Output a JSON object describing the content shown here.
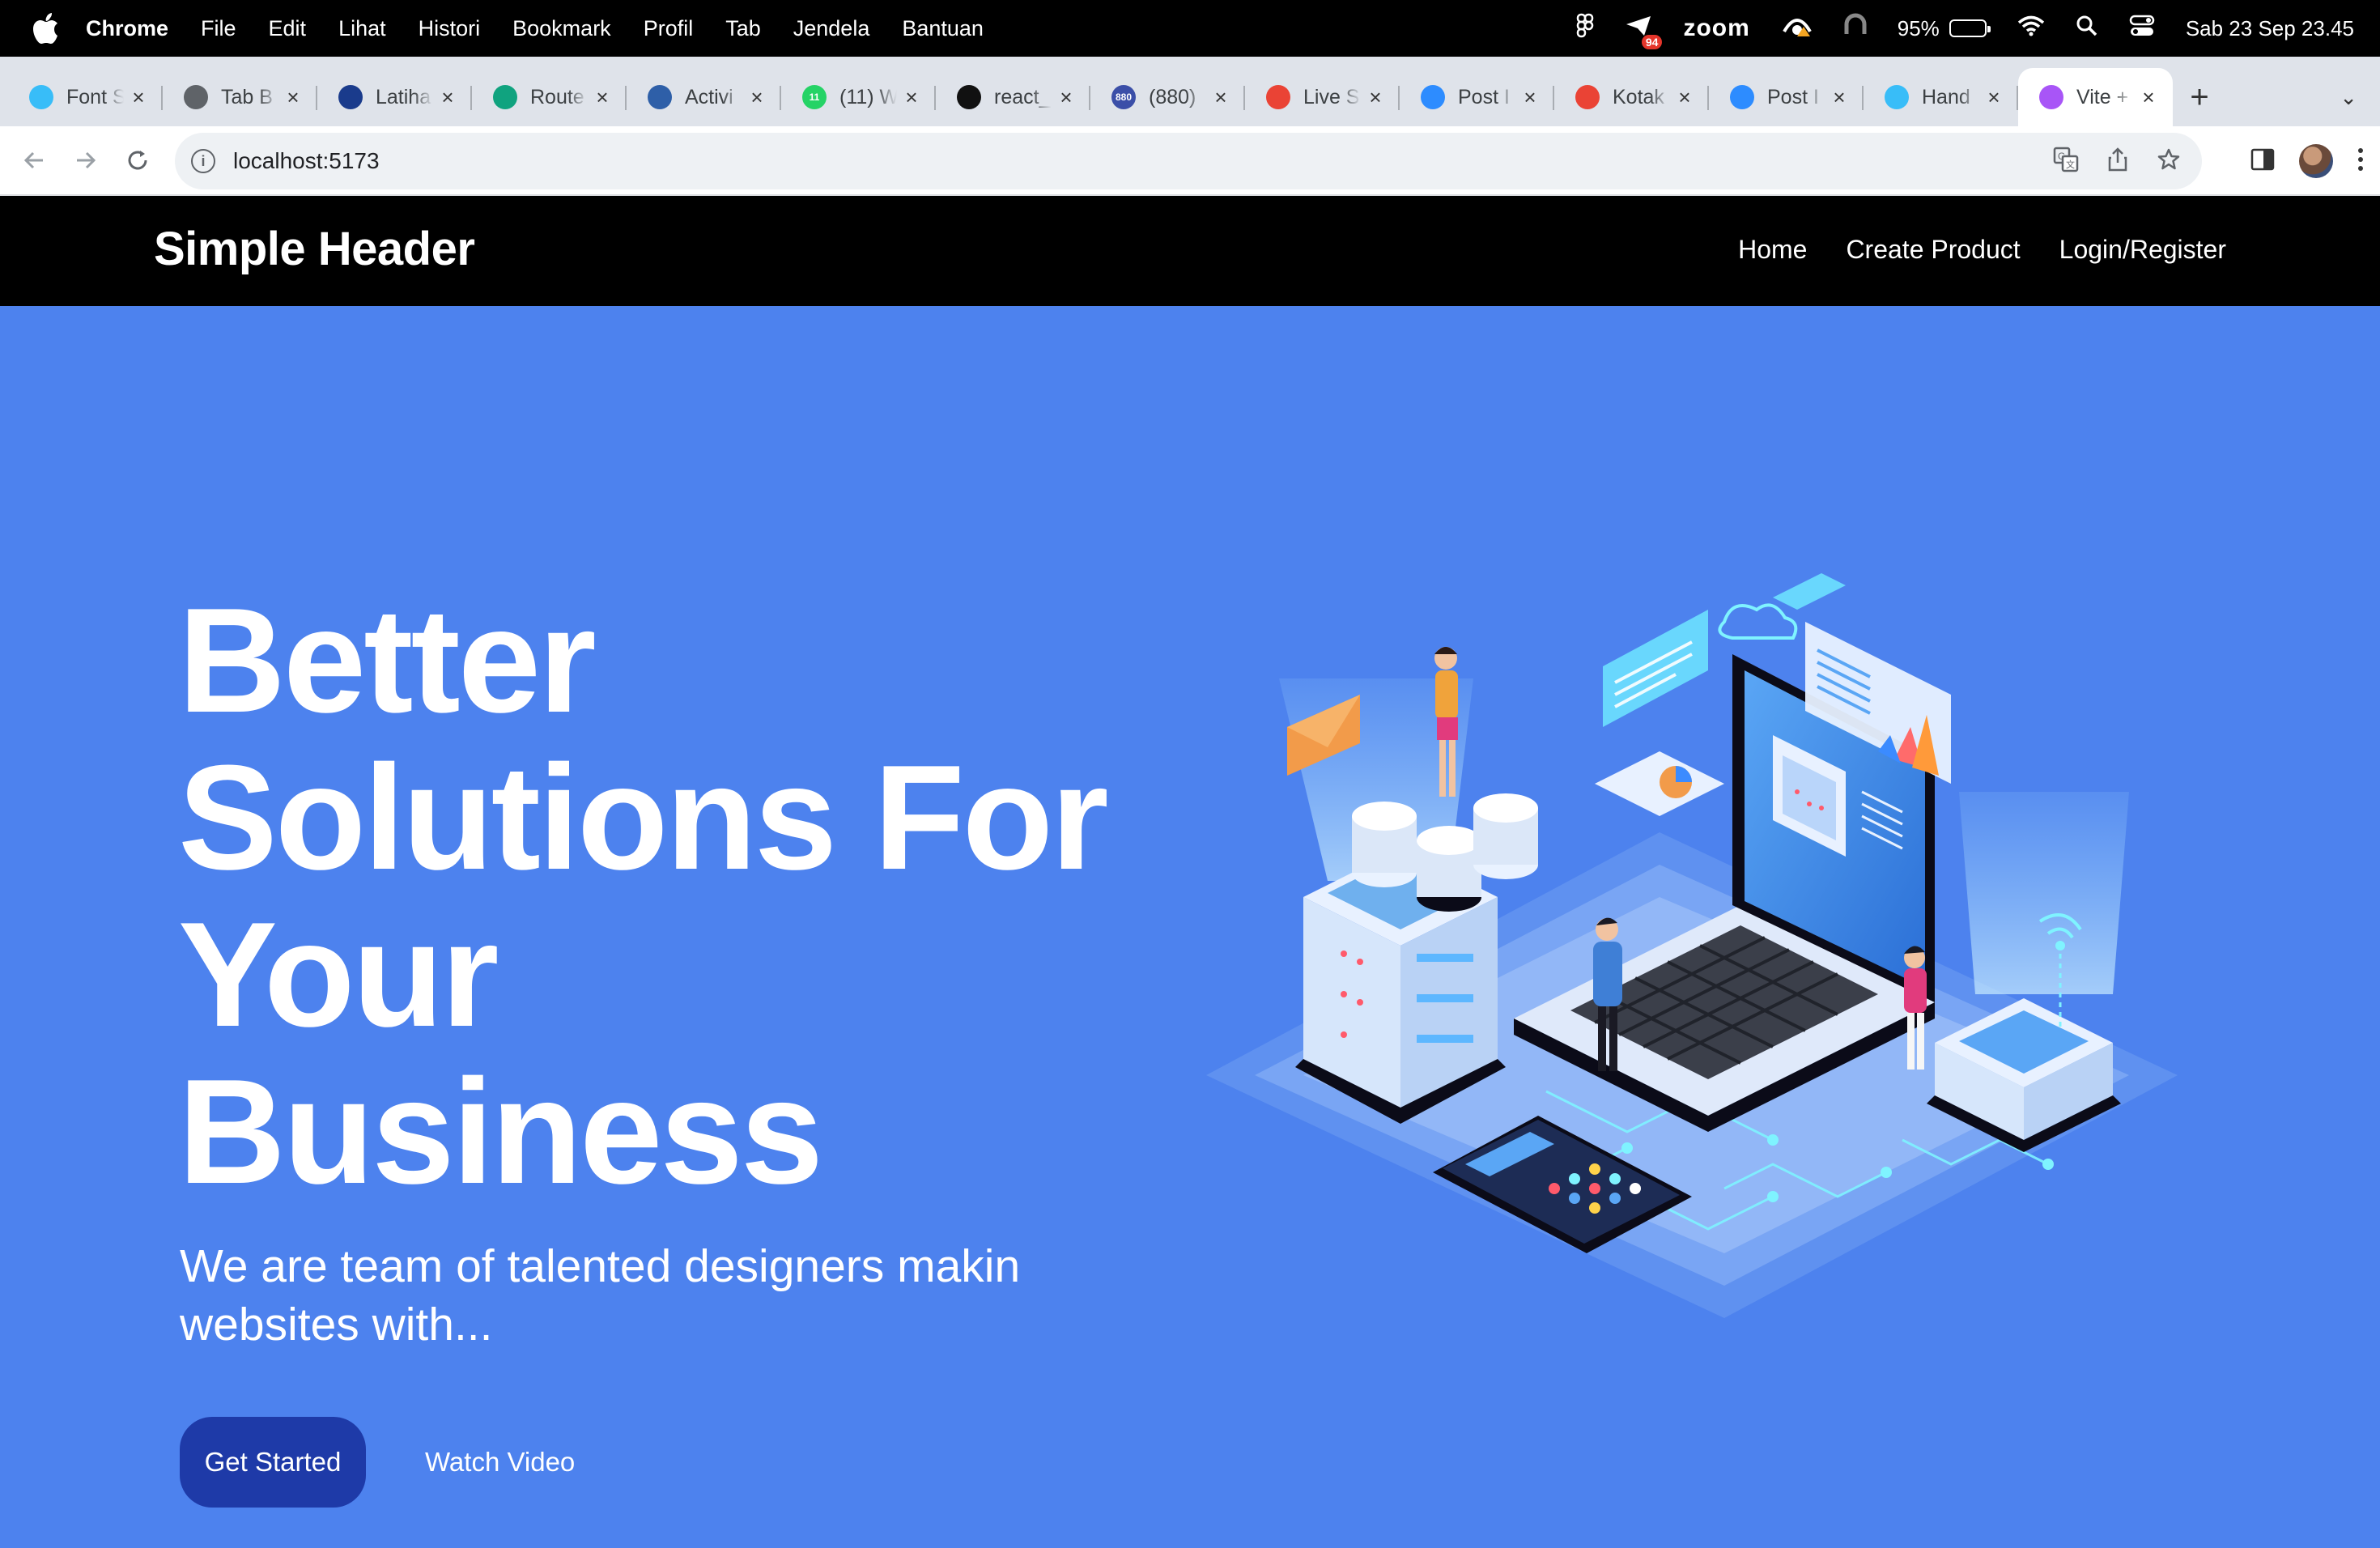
{
  "menubar": {
    "app": "Chrome",
    "items": [
      "File",
      "Edit",
      "Lihat",
      "Histori",
      "Bookmark",
      "Profil",
      "Tab",
      "Jendela",
      "Bantuan"
    ],
    "status": {
      "mail_badge": "94",
      "zoom": "zoom",
      "battery": "95%",
      "battery_level": 0.95,
      "datetime": "Sab 23 Sep  23.45"
    }
  },
  "tabs": [
    {
      "title": "Font S",
      "icon": "tailwind-icon",
      "color": "#38bdf8"
    },
    {
      "title": "Tab B",
      "icon": "chrome-icon",
      "color": "#5f6368"
    },
    {
      "title": "Latiha",
      "icon": "one-logo-icon",
      "color": "#1a3b8c"
    },
    {
      "title": "Route",
      "icon": "openai-icon",
      "color": "#10a37f"
    },
    {
      "title": "Activi",
      "icon": "activity-icon",
      "color": "#2e5fa8"
    },
    {
      "title": "(11) W",
      "icon": "whatsapp-icon",
      "color": "#25d366",
      "badge": "11"
    },
    {
      "title": "react_",
      "icon": "github-icon",
      "color": "#111111"
    },
    {
      "title": "(880)",
      "icon": "mail-badge-icon",
      "color": "#3b4fa8",
      "badge": "880"
    },
    {
      "title": "Live S",
      "icon": "gmail-icon",
      "color": "#ea4335"
    },
    {
      "title": "Post I",
      "icon": "zoom-icon",
      "color": "#2d8cff"
    },
    {
      "title": "Kotak",
      "icon": "gmail-icon",
      "color": "#ea4335"
    },
    {
      "title": "Post I",
      "icon": "zoom-icon",
      "color": "#2d8cff"
    },
    {
      "title": "Hand",
      "icon": "tailwind-icon",
      "color": "#38bdf8"
    },
    {
      "title": "Vite +",
      "icon": "vite-icon",
      "color": "#a855f7",
      "active": true
    }
  ],
  "address": {
    "url": "localhost:5173"
  },
  "site": {
    "brand": "Simple Header",
    "nav": [
      "Home",
      "Create Product",
      "Login/Register"
    ]
  },
  "hero": {
    "headline_lines": [
      "Better",
      "Solutions For",
      "Your",
      "Business"
    ],
    "subtitle": "We are team of talented designers makin websites with...",
    "primary_cta": "Get Started",
    "secondary_cta": "Watch Video"
  },
  "colors": {
    "hero_bg": "#4d82ee",
    "header_bg": "#000000",
    "primary_button": "#1e3aa8"
  }
}
